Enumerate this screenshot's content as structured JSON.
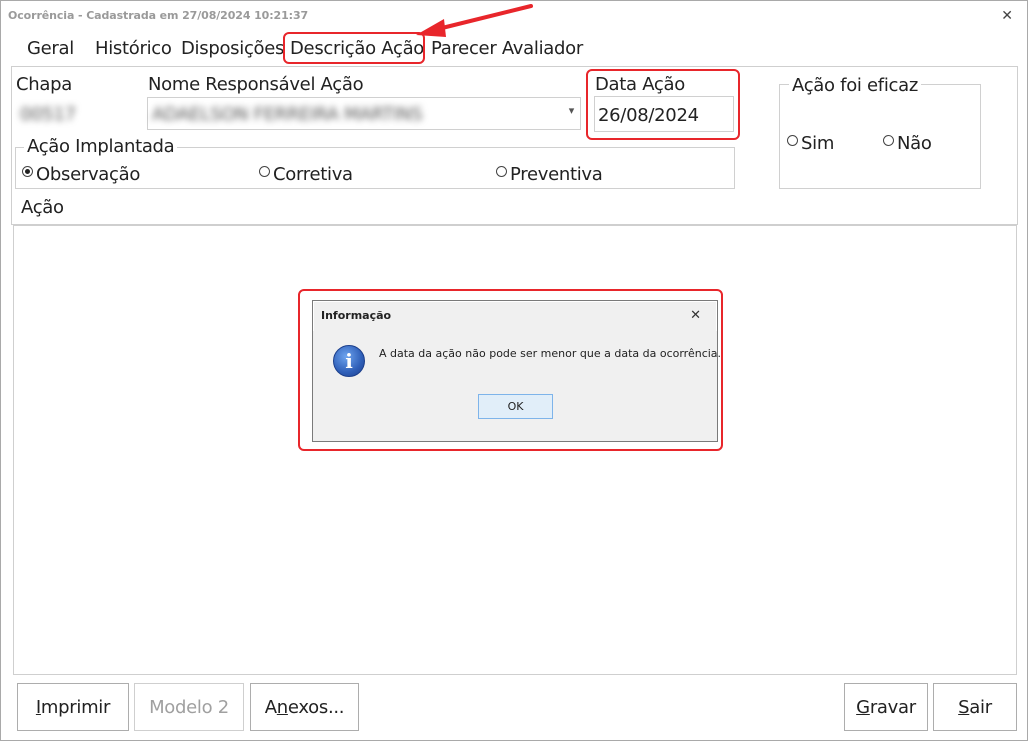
{
  "window": {
    "title": "Ocorrência - Cadastrada em 27/08/2024 10:21:37",
    "close_glyph": "✕"
  },
  "tabs": [
    {
      "label": "Geral"
    },
    {
      "label": "Histórico"
    },
    {
      "label": "Disposições"
    },
    {
      "label": "Descrição Ação",
      "active": true
    },
    {
      "label": "Parecer Avaliador"
    }
  ],
  "form": {
    "chapa_label": "Chapa",
    "chapa_value": "00517",
    "responsavel_label": "Nome Responsável Ação",
    "responsavel_value": "ADAELSON FERREIRA MARTINS",
    "data_label": "Data Ação",
    "data_value": "26/08/2024",
    "eficaz_label": "Ação foi eficaz",
    "eficaz_options": [
      "Sim",
      "Não"
    ],
    "implantada_label": "Ação Implantada",
    "implantada_options": [
      "Observação",
      "Corretiva",
      "Preventiva"
    ],
    "implantada_selected": "Observação",
    "acao_label": "Ação",
    "dropdown_glyph": "▾"
  },
  "dialog": {
    "title": "Informação",
    "close_glyph": "✕",
    "message": "A data da ação não pode ser menor que a data da ocorrência.",
    "icon": "info-icon",
    "icon_glyph": "i",
    "ok_label": "OK"
  },
  "buttons": {
    "imprimir_pre": "",
    "imprimir_u": "I",
    "imprimir_post": "mprimir",
    "modelo2": "Modelo 2",
    "anexos_pre": "A",
    "anexos_u": "n",
    "anexos_post": "exos...",
    "gravar_pre": "",
    "gravar_u": "G",
    "gravar_post": "ravar",
    "sair_pre": "",
    "sair_u": "S",
    "sair_post": "air"
  },
  "colors": {
    "highlight": "#e8262b",
    "ok_button_bg": "#e1eef9",
    "ok_button_border": "#7eb4ea",
    "info_icon": "#2f5fb8"
  }
}
